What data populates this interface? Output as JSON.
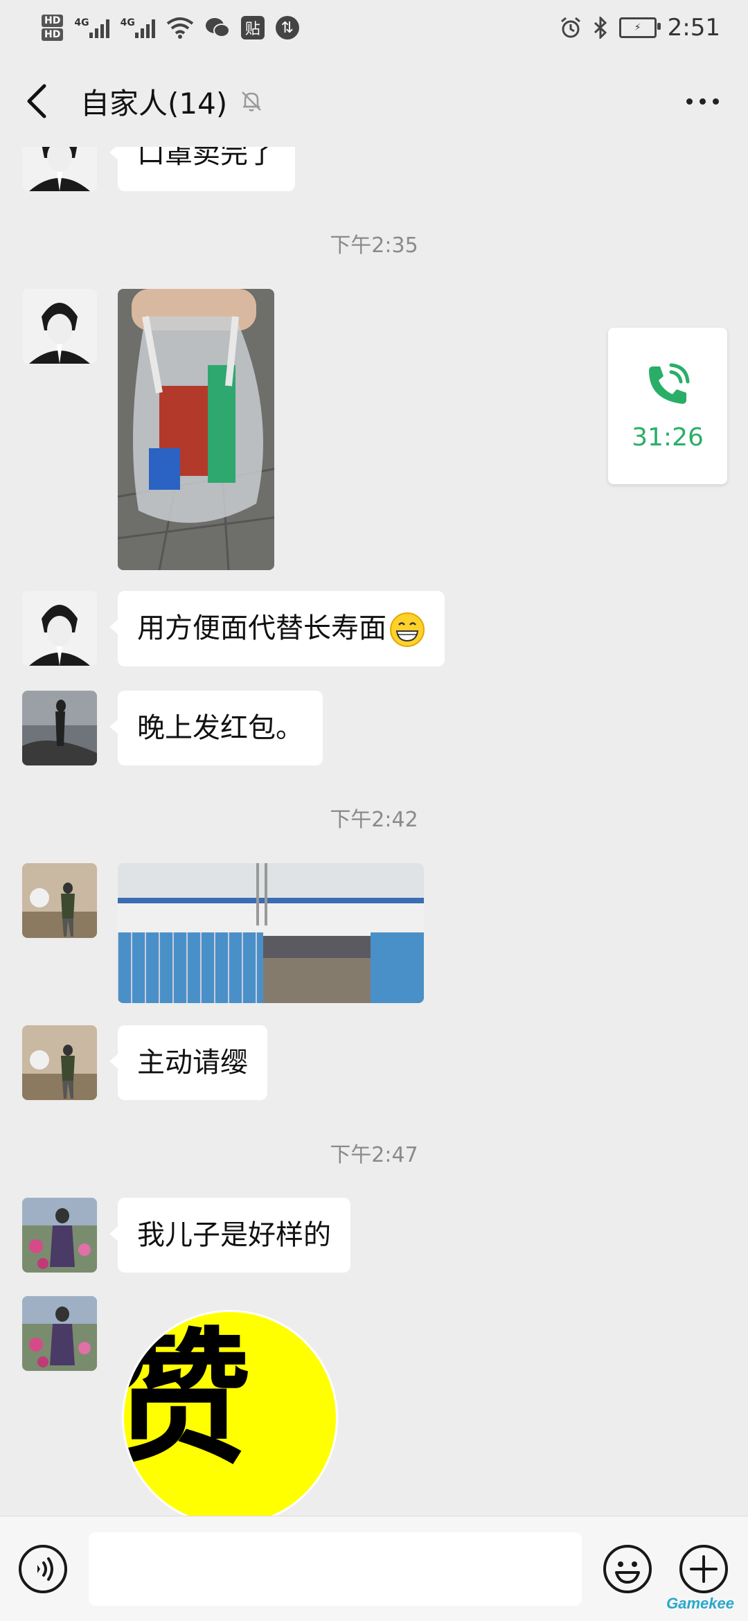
{
  "status_bar": {
    "hd1": "HD",
    "hd2": "HD",
    "net1": "4G",
    "net2": "4G",
    "tile_label": "贴",
    "time": "2:51"
  },
  "header": {
    "title": "自家人(14)"
  },
  "timestamps": [
    "下午2:35",
    "下午2:42",
    "下午2:47"
  ],
  "messages": {
    "m0": "口罩卖完了",
    "m3": "用方便面代替长寿面",
    "m4": "晚上发红包。",
    "m6": "主动请缨",
    "m7": "我儿子是好样的",
    "sticker_text": "赞"
  },
  "call_card": {
    "duration": "31:26"
  },
  "input": {
    "placeholder": ""
  },
  "colors": {
    "background": "#ededed",
    "bubble": "#ffffff",
    "call_green": "#2aae67",
    "sticker_yellow": "#ffff00"
  }
}
